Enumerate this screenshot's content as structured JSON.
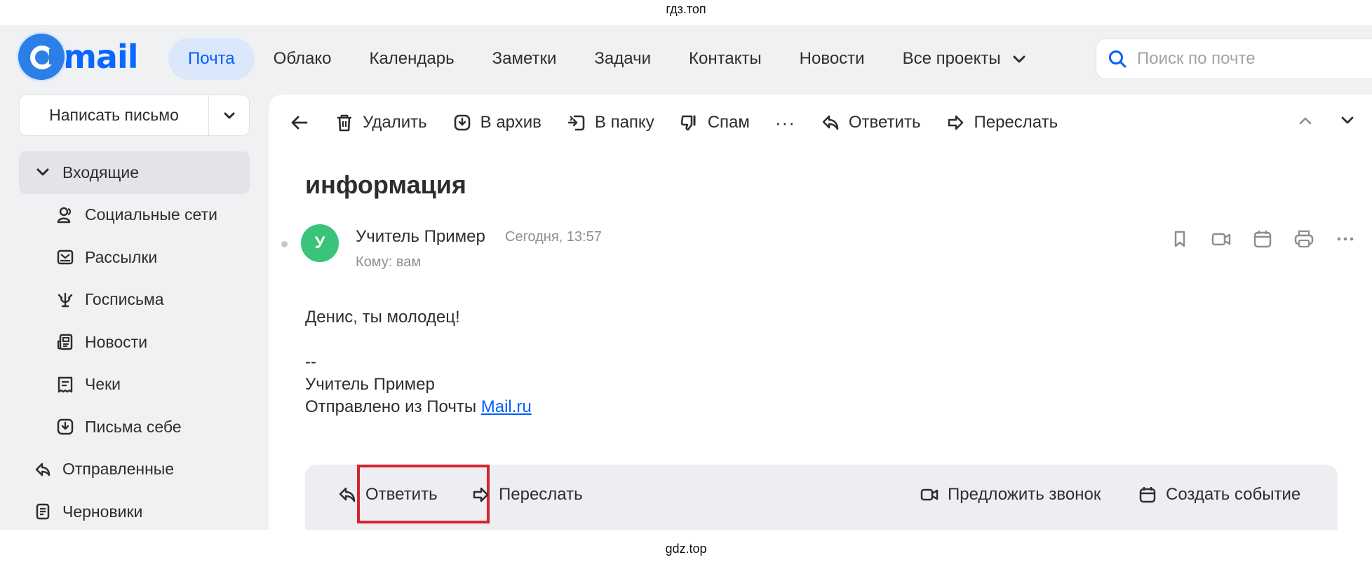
{
  "watermark_top": "гдз.топ",
  "watermark_bottom": "gdz.top",
  "header": {
    "logo_text": "mail",
    "nav": [
      {
        "label": "Почта",
        "active": true
      },
      {
        "label": "Облако"
      },
      {
        "label": "Календарь"
      },
      {
        "label": "Заметки"
      },
      {
        "label": "Задачи"
      },
      {
        "label": "Контакты"
      },
      {
        "label": "Новости"
      },
      {
        "label": "Все проекты"
      }
    ],
    "search_placeholder": "Поиск по почте"
  },
  "sidebar": {
    "compose_label": "Написать письмо",
    "folders": [
      {
        "label": "Входящие",
        "icon": "chevron-down-icon"
      },
      {
        "label": "Социальные сети",
        "icon": "people-icon"
      },
      {
        "label": "Рассылки",
        "icon": "newsletter-icon"
      },
      {
        "label": "Госписьма",
        "icon": "emblem-icon"
      },
      {
        "label": "Новости",
        "icon": "news-icon"
      },
      {
        "label": "Чеки",
        "icon": "receipt-icon"
      },
      {
        "label": "Письма себе",
        "icon": "self-mail-icon"
      },
      {
        "label": "Отправленные",
        "icon": "sent-icon"
      },
      {
        "label": "Черновики",
        "icon": "draft-icon"
      }
    ]
  },
  "toolbar": {
    "delete": "Удалить",
    "archive": "В архив",
    "to_folder": "В папку",
    "spam": "Спам",
    "more": "···",
    "reply": "Ответить",
    "forward": "Переслать"
  },
  "message": {
    "subject": "информация",
    "avatar_letter": "У",
    "sender": "Учитель Пример",
    "time": "Сегодня, 13:57",
    "to": "Кому: вам",
    "body_lines": [
      "Денис, ты молодец!",
      "",
      "--",
      "Учитель Пример"
    ],
    "footer_prefix": "Отправлено из Почты ",
    "footer_link": "Mail.ru"
  },
  "reply_bar": {
    "reply": "Ответить",
    "forward": "Переслать",
    "call": "Предложить звонок",
    "event": "Создать событие"
  },
  "colors": {
    "accent": "#005ff9",
    "highlight": "#d5242e",
    "avatar": "#3ac37a"
  }
}
